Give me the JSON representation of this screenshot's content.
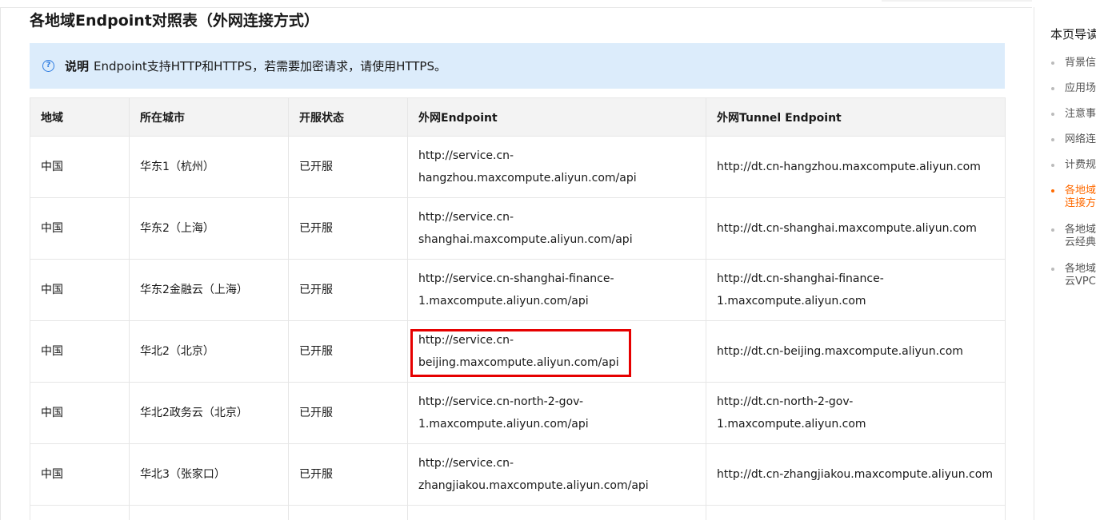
{
  "heading": "各地域Endpoint对照表（外网连接方式）",
  "note": {
    "icon": "question-circle-icon",
    "label": "说明",
    "text": "Endpoint支持HTTP和HTTPS，若需要加密请求，请使用HTTPS。"
  },
  "table": {
    "headers": [
      "地域",
      "所在城市",
      "开服状态",
      "外网Endpoint",
      "外网Tunnel Endpoint"
    ],
    "rows": [
      {
        "region": "中国",
        "city": "华东1（杭州）",
        "status": "已开服",
        "endpoint_1": "http://service.cn-",
        "endpoint_2": "hangzhou.maxcompute.aliyun.com/api",
        "tunnel_1": "http://dt.cn-hangzhou.maxcompute.aliyun.com",
        "tunnel_2": ""
      },
      {
        "region": "中国",
        "city": "华东2（上海）",
        "status": "已开服",
        "endpoint_1": "http://service.cn-",
        "endpoint_2": "shanghai.maxcompute.aliyun.com/api",
        "tunnel_1": "http://dt.cn-shanghai.maxcompute.aliyun.com",
        "tunnel_2": ""
      },
      {
        "region": "中国",
        "city": "华东2金融云（上海）",
        "status": "已开服",
        "endpoint_1": "http://service.cn-shanghai-finance-",
        "endpoint_2": "1.maxcompute.aliyun.com/api",
        "tunnel_1": "http://dt.cn-shanghai-finance-",
        "tunnel_2": "1.maxcompute.aliyun.com"
      },
      {
        "region": "中国",
        "city": "华北2（北京）",
        "status": "已开服",
        "endpoint_1": "http://service.cn-",
        "endpoint_2": "beijing.maxcompute.aliyun.com/api",
        "tunnel_1": "http://dt.cn-beijing.maxcompute.aliyun.com",
        "tunnel_2": ""
      },
      {
        "region": "中国",
        "city": "华北2政务云（北京）",
        "status": "已开服",
        "endpoint_1": "http://service.cn-north-2-gov-",
        "endpoint_2": "1.maxcompute.aliyun.com/api",
        "tunnel_1": "http://dt.cn-north-2-gov-1.maxcompute.aliyun.com",
        "tunnel_2": ""
      },
      {
        "region": "中国",
        "city": "华北3（张家口）",
        "status": "已开服",
        "endpoint_1": "http://service.cn-",
        "endpoint_2": "zhangjiakou.maxcompute.aliyun.com/api",
        "tunnel_1": "http://dt.cn-zhangjiakou.maxcompute.aliyun.com",
        "tunnel_2": ""
      }
    ]
  },
  "toc": {
    "title": "本页导读",
    "items": [
      {
        "line1": "背景信息",
        "line2": ""
      },
      {
        "line1": "应用场景",
        "line2": ""
      },
      {
        "line1": "注意事项",
        "line2": ""
      },
      {
        "line1": "网络连接",
        "line2": ""
      },
      {
        "line1": "计费规则",
        "line2": ""
      },
      {
        "line1": "各地域",
        "line2": "连接方式"
      },
      {
        "line1": "各地域",
        "line2": "云经典"
      },
      {
        "line1": "各地域",
        "line2": "云VPC"
      }
    ]
  },
  "colors": {
    "accent": "#ff6a00",
    "note_bg": "#dcecfb",
    "note_icon": "#2f7de1",
    "highlight_box": "#e60000",
    "header_bg": "#f3f3f3"
  }
}
